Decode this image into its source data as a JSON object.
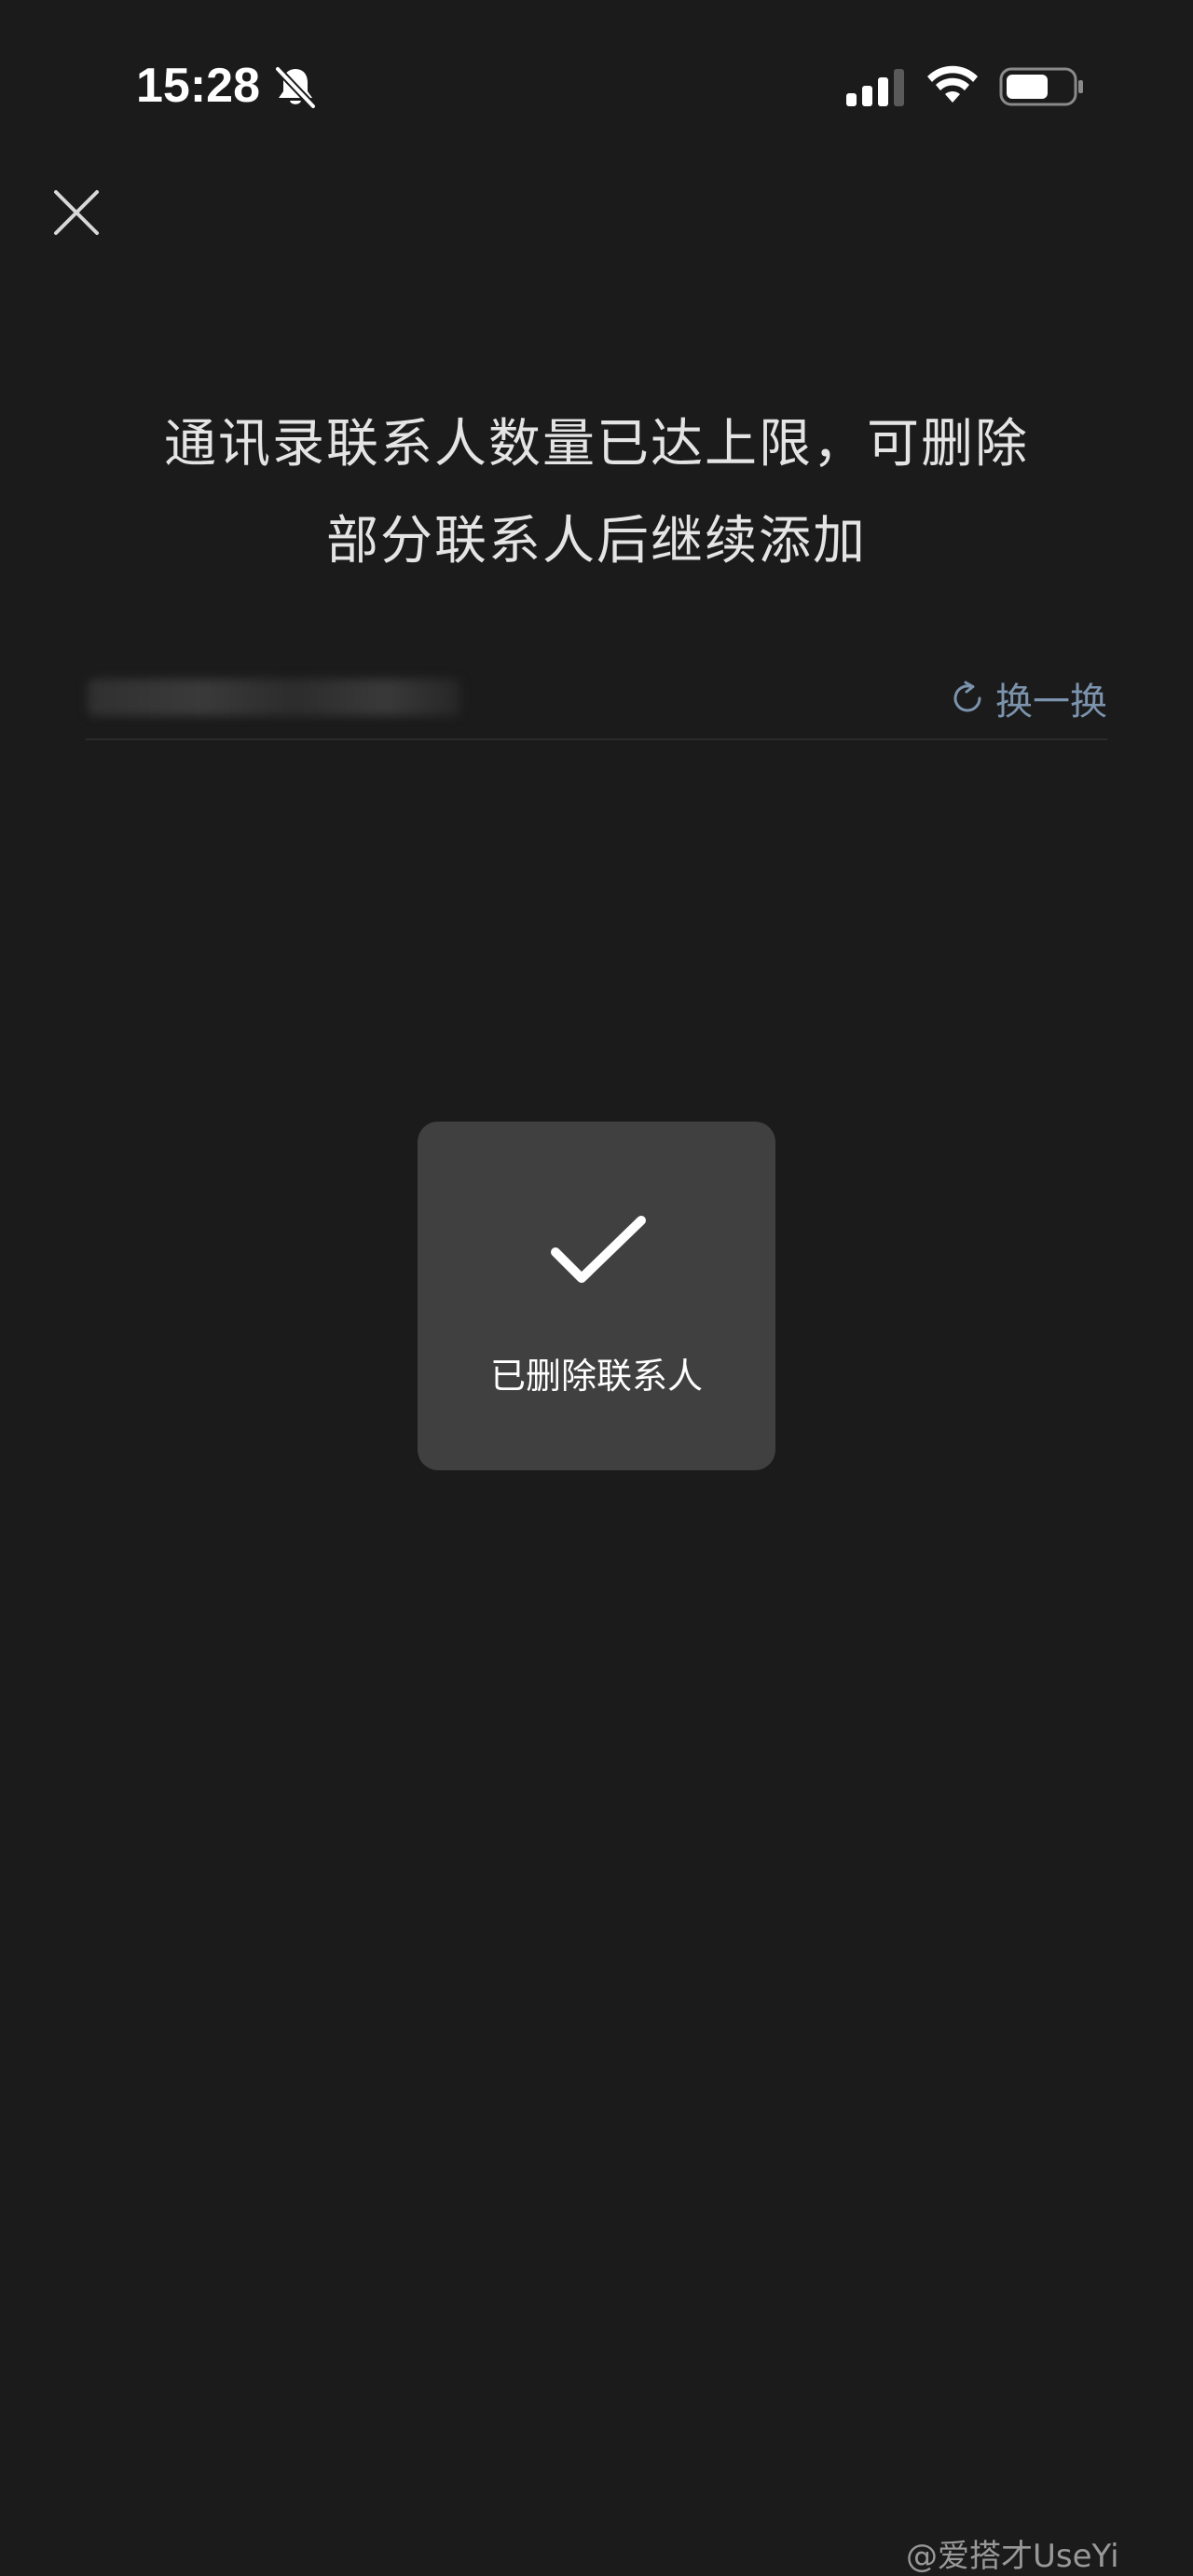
{
  "status_bar": {
    "time": "15:28",
    "icons": [
      "bell-muted-icon",
      "cellular-signal-icon",
      "wifi-icon",
      "battery-icon"
    ]
  },
  "header": {
    "close_icon": "close-icon"
  },
  "main": {
    "title_line1": "通讯录联系人数量已达上限，可删除",
    "title_line2": "部分联系人后继续添加",
    "refresh_label": "换一换"
  },
  "toast": {
    "icon": "checkmark-icon",
    "message": "已删除联系人"
  },
  "watermark": {
    "text": "@爱搭才UseYi"
  },
  "colors": {
    "background": "#1b1b1b",
    "toast_background": "#404040",
    "accent_link": "#7b93ad",
    "text_primary": "#e4e4e4"
  }
}
